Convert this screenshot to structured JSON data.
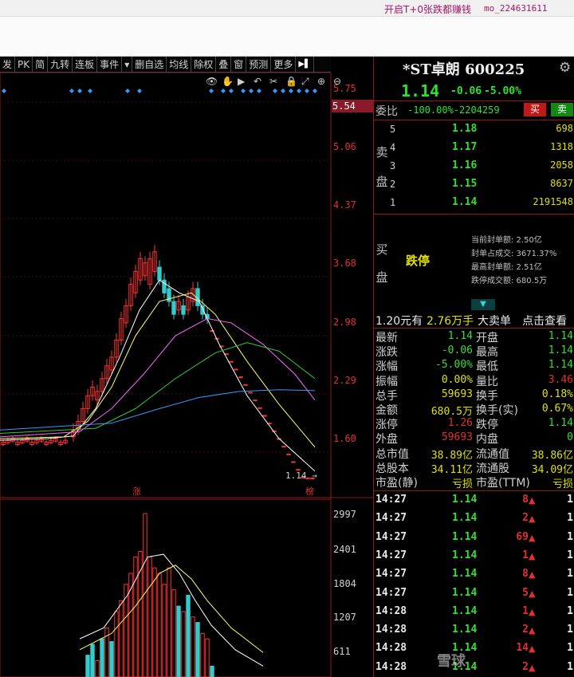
{
  "topbar": {
    "promo": "开启T+0张跌都赚钱",
    "user": "mo_224631611"
  },
  "toolbar": {
    "items": [
      "发",
      "PK",
      "简",
      "九转",
      "连板",
      "事件",
      "▾",
      "删自选",
      "均线",
      "除权",
      "叠",
      "窗",
      "预测",
      "更多"
    ],
    "end_icon": "▶▌"
  },
  "chart": {
    "price_labels": [
      "5.75",
      "5.06",
      "4.37",
      "3.68",
      "2.98",
      "2.29",
      "1.60"
    ],
    "current_box": "5.54",
    "low_label": "1.14",
    "zhang_tag": "涨",
    "bang_tag": "榜",
    "volume_labels": [
      "2997",
      "2401",
      "1804",
      "1207",
      "611"
    ],
    "icons": [
      "eye-icon",
      "hand-icon",
      "play-icon",
      "undo-icon",
      "scissors-icon",
      "lock-icon",
      "expand-icon",
      "zoom-in-icon",
      "zoom-out-icon"
    ],
    "colors": {
      "up": "#ff3333",
      "down": "#33cccc",
      "ma5": "#ffffff",
      "ma10": "#ffff66",
      "ma20": "#ff66ff",
      "ma30": "#33cc33",
      "ma60": "#3399ff"
    }
  },
  "stock": {
    "name": "*ST卓朗",
    "code": "600225",
    "price": "1.14",
    "change": "-0.06",
    "change_pct": "-5.00%"
  },
  "weibi": {
    "label": "委比",
    "value": "-100.00%-2204259",
    "buy": "买",
    "sell": "卖"
  },
  "sell_side": {
    "label": [
      "卖",
      "盘"
    ],
    "rows": [
      {
        "lvl": "5",
        "px": "1.18",
        "vol": "698"
      },
      {
        "lvl": "4",
        "px": "1.17",
        "vol": "1318"
      },
      {
        "lvl": "3",
        "px": "1.16",
        "vol": "2058"
      },
      {
        "lvl": "2",
        "px": "1.15",
        "vol": "8637"
      },
      {
        "lvl": "1",
        "px": "1.14",
        "vol": "2191548"
      }
    ]
  },
  "buy_side": {
    "label": [
      "买",
      "盘"
    ],
    "status": "跌停",
    "info": [
      "当前封单额: 2.50亿",
      "封单占成交: 3671.37%",
      "最高封单额: 2.51亿",
      "跌停成交额: 680.5万"
    ]
  },
  "quote_bar": {
    "a": "1.20元有",
    "b": "2.76万手",
    "c": "大卖单",
    "d": "点击查看"
  },
  "stats": [
    {
      "k": "最新",
      "v": "1.14",
      "c": "#2fe02f"
    },
    {
      "k": "开盘",
      "v": "1.14",
      "c": "#2fe02f"
    },
    {
      "k": "涨跌",
      "v": "-0.06",
      "c": "#2fe02f"
    },
    {
      "k": "最高",
      "v": "1.14",
      "c": "#2fe02f"
    },
    {
      "k": "涨幅",
      "v": "-5.00%",
      "c": "#2fe02f"
    },
    {
      "k": "最低",
      "v": "1.14",
      "c": "#2fe02f"
    },
    {
      "k": "振幅",
      "v": "0.00%",
      "c": "#e0e000"
    },
    {
      "k": "量比",
      "v": "3.46",
      "c": "#e03030"
    },
    {
      "k": "总手",
      "v": "59693",
      "c": "#e0e000"
    },
    {
      "k": "换手",
      "v": "0.18%",
      "c": "#e0e000"
    },
    {
      "k": "金额",
      "v": "680.5万",
      "c": "#e0e000"
    },
    {
      "k": "换手(实)",
      "v": "0.67%",
      "c": "#e0e000"
    },
    {
      "k": "涨停",
      "v": "1.26",
      "c": "#e03030"
    },
    {
      "k": "跌停",
      "v": "1.14",
      "c": "#2fe02f"
    },
    {
      "k": "外盘",
      "v": "59693",
      "c": "#e03030"
    },
    {
      "k": "内盘",
      "v": "0",
      "c": "#2fe02f"
    },
    {
      "k": "总市值",
      "v": "38.89亿",
      "c": "#e0e000"
    },
    {
      "k": "流通值",
      "v": "38.86亿",
      "c": "#e0e000"
    },
    {
      "k": "总股本",
      "v": "34.11亿",
      "c": "#e0e000"
    },
    {
      "k": "流通股",
      "v": "34.09亿",
      "c": "#e0e000"
    },
    {
      "k": "市盈(静)",
      "v": "亏损",
      "c": "#e0e000"
    },
    {
      "k": "市盈(TTM)",
      "v": "亏损",
      "c": "#e0e000"
    }
  ],
  "ticks": [
    {
      "t": "14:27",
      "p": "1.14",
      "q": "8",
      "n": "1"
    },
    {
      "t": "14:27",
      "p": "1.14",
      "q": "2",
      "n": "1"
    },
    {
      "t": "14:27",
      "p": "1.14",
      "q": "69",
      "n": "1"
    },
    {
      "t": "14:27",
      "p": "1.14",
      "q": "1",
      "n": "1"
    },
    {
      "t": "14:27",
      "p": "1.14",
      "q": "8",
      "n": "1"
    },
    {
      "t": "14:27",
      "p": "1.14",
      "q": "5",
      "n": "1"
    },
    {
      "t": "14:28",
      "p": "1.14",
      "q": "1",
      "n": "1"
    },
    {
      "t": "14:28",
      "p": "1.14",
      "q": "2",
      "n": "1"
    },
    {
      "t": "14:28",
      "p": "1.14",
      "q": "14",
      "n": "1"
    },
    {
      "t": "14:28",
      "p": "1.14",
      "q": "2",
      "n": "1"
    }
  ],
  "watermark": "雪球"
}
